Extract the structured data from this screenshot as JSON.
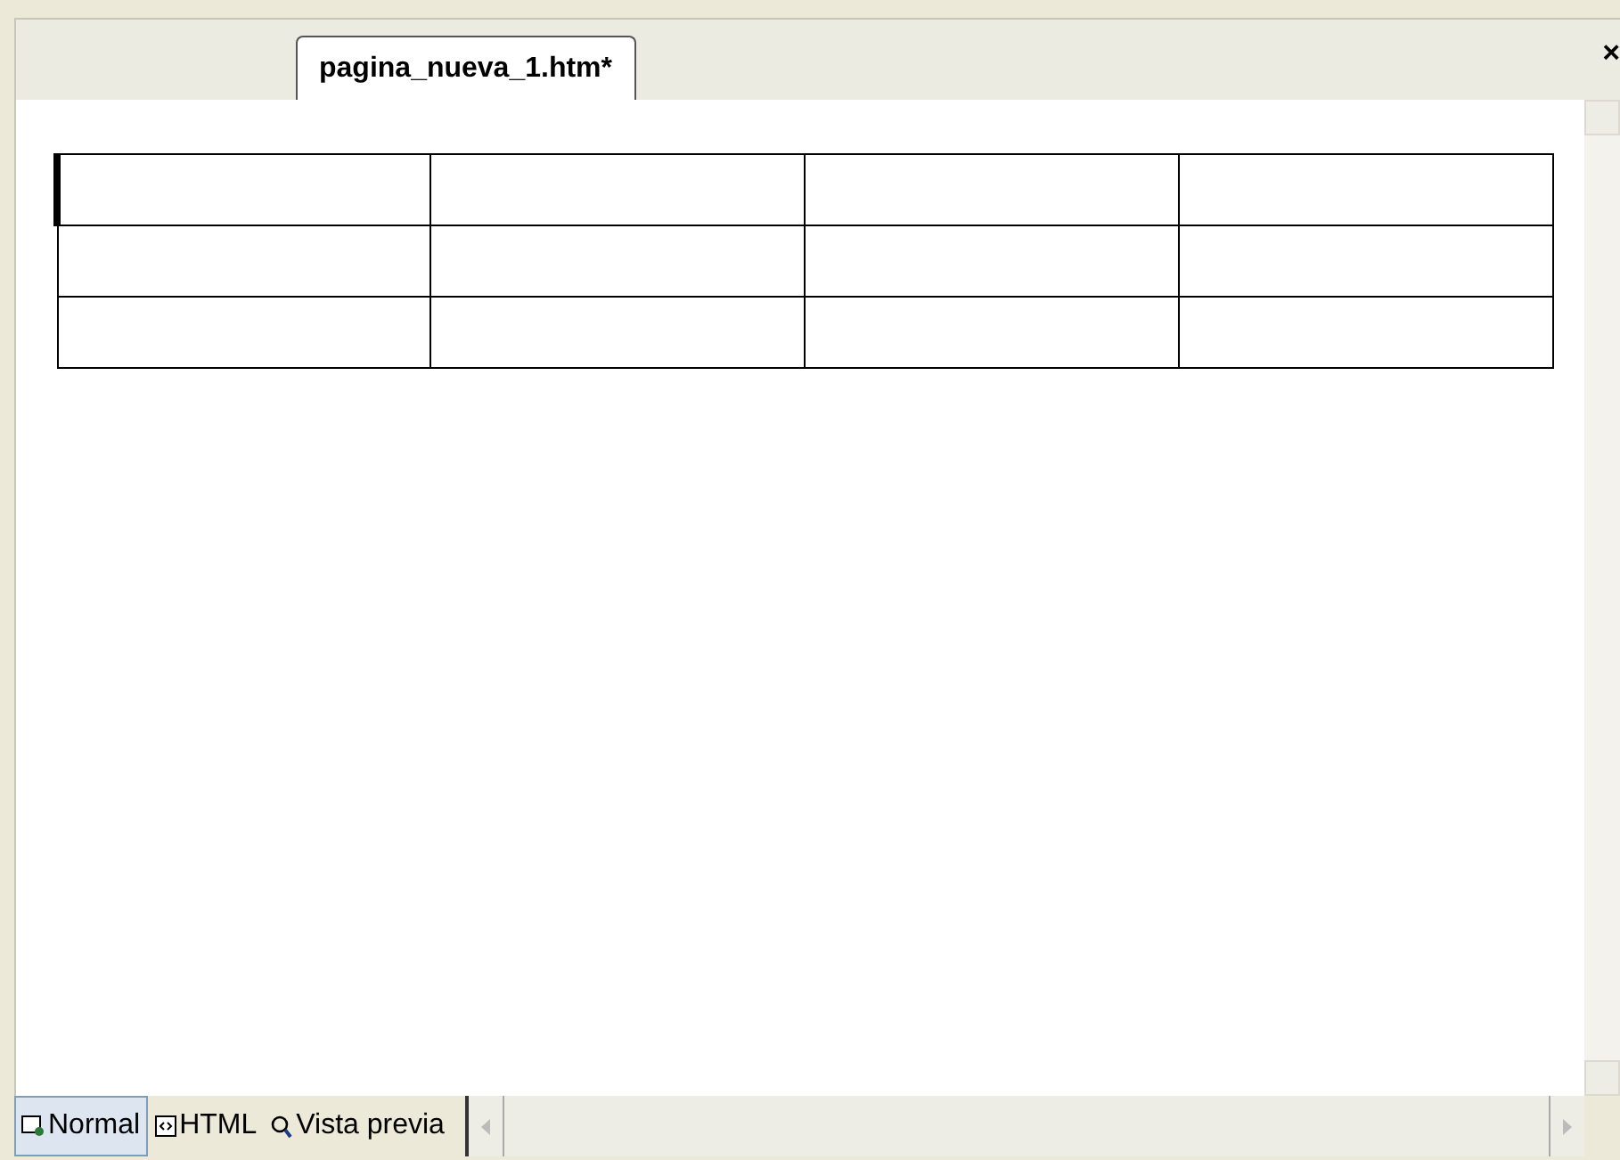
{
  "document_tab": {
    "title": "pagina_nueva_1.htm*"
  },
  "close_button": {
    "label": "×"
  },
  "table": {
    "rows": [
      {
        "cells": [
          {
            "caret": true
          },
          {
            "caret": false
          },
          {
            "caret": false
          },
          {
            "caret": false
          }
        ]
      },
      {
        "cells": [
          {
            "caret": false
          },
          {
            "caret": false
          },
          {
            "caret": false
          },
          {
            "caret": false
          }
        ]
      },
      {
        "cells": [
          {
            "caret": false
          },
          {
            "caret": false
          },
          {
            "caret": false
          },
          {
            "caret": false
          }
        ]
      }
    ]
  },
  "view_tabs": [
    {
      "label": "Normal",
      "kind": "normal",
      "selected": true
    },
    {
      "label": "HTML",
      "kind": "html",
      "selected": false
    },
    {
      "label": "Vista previa",
      "kind": "preview",
      "selected": false
    }
  ]
}
